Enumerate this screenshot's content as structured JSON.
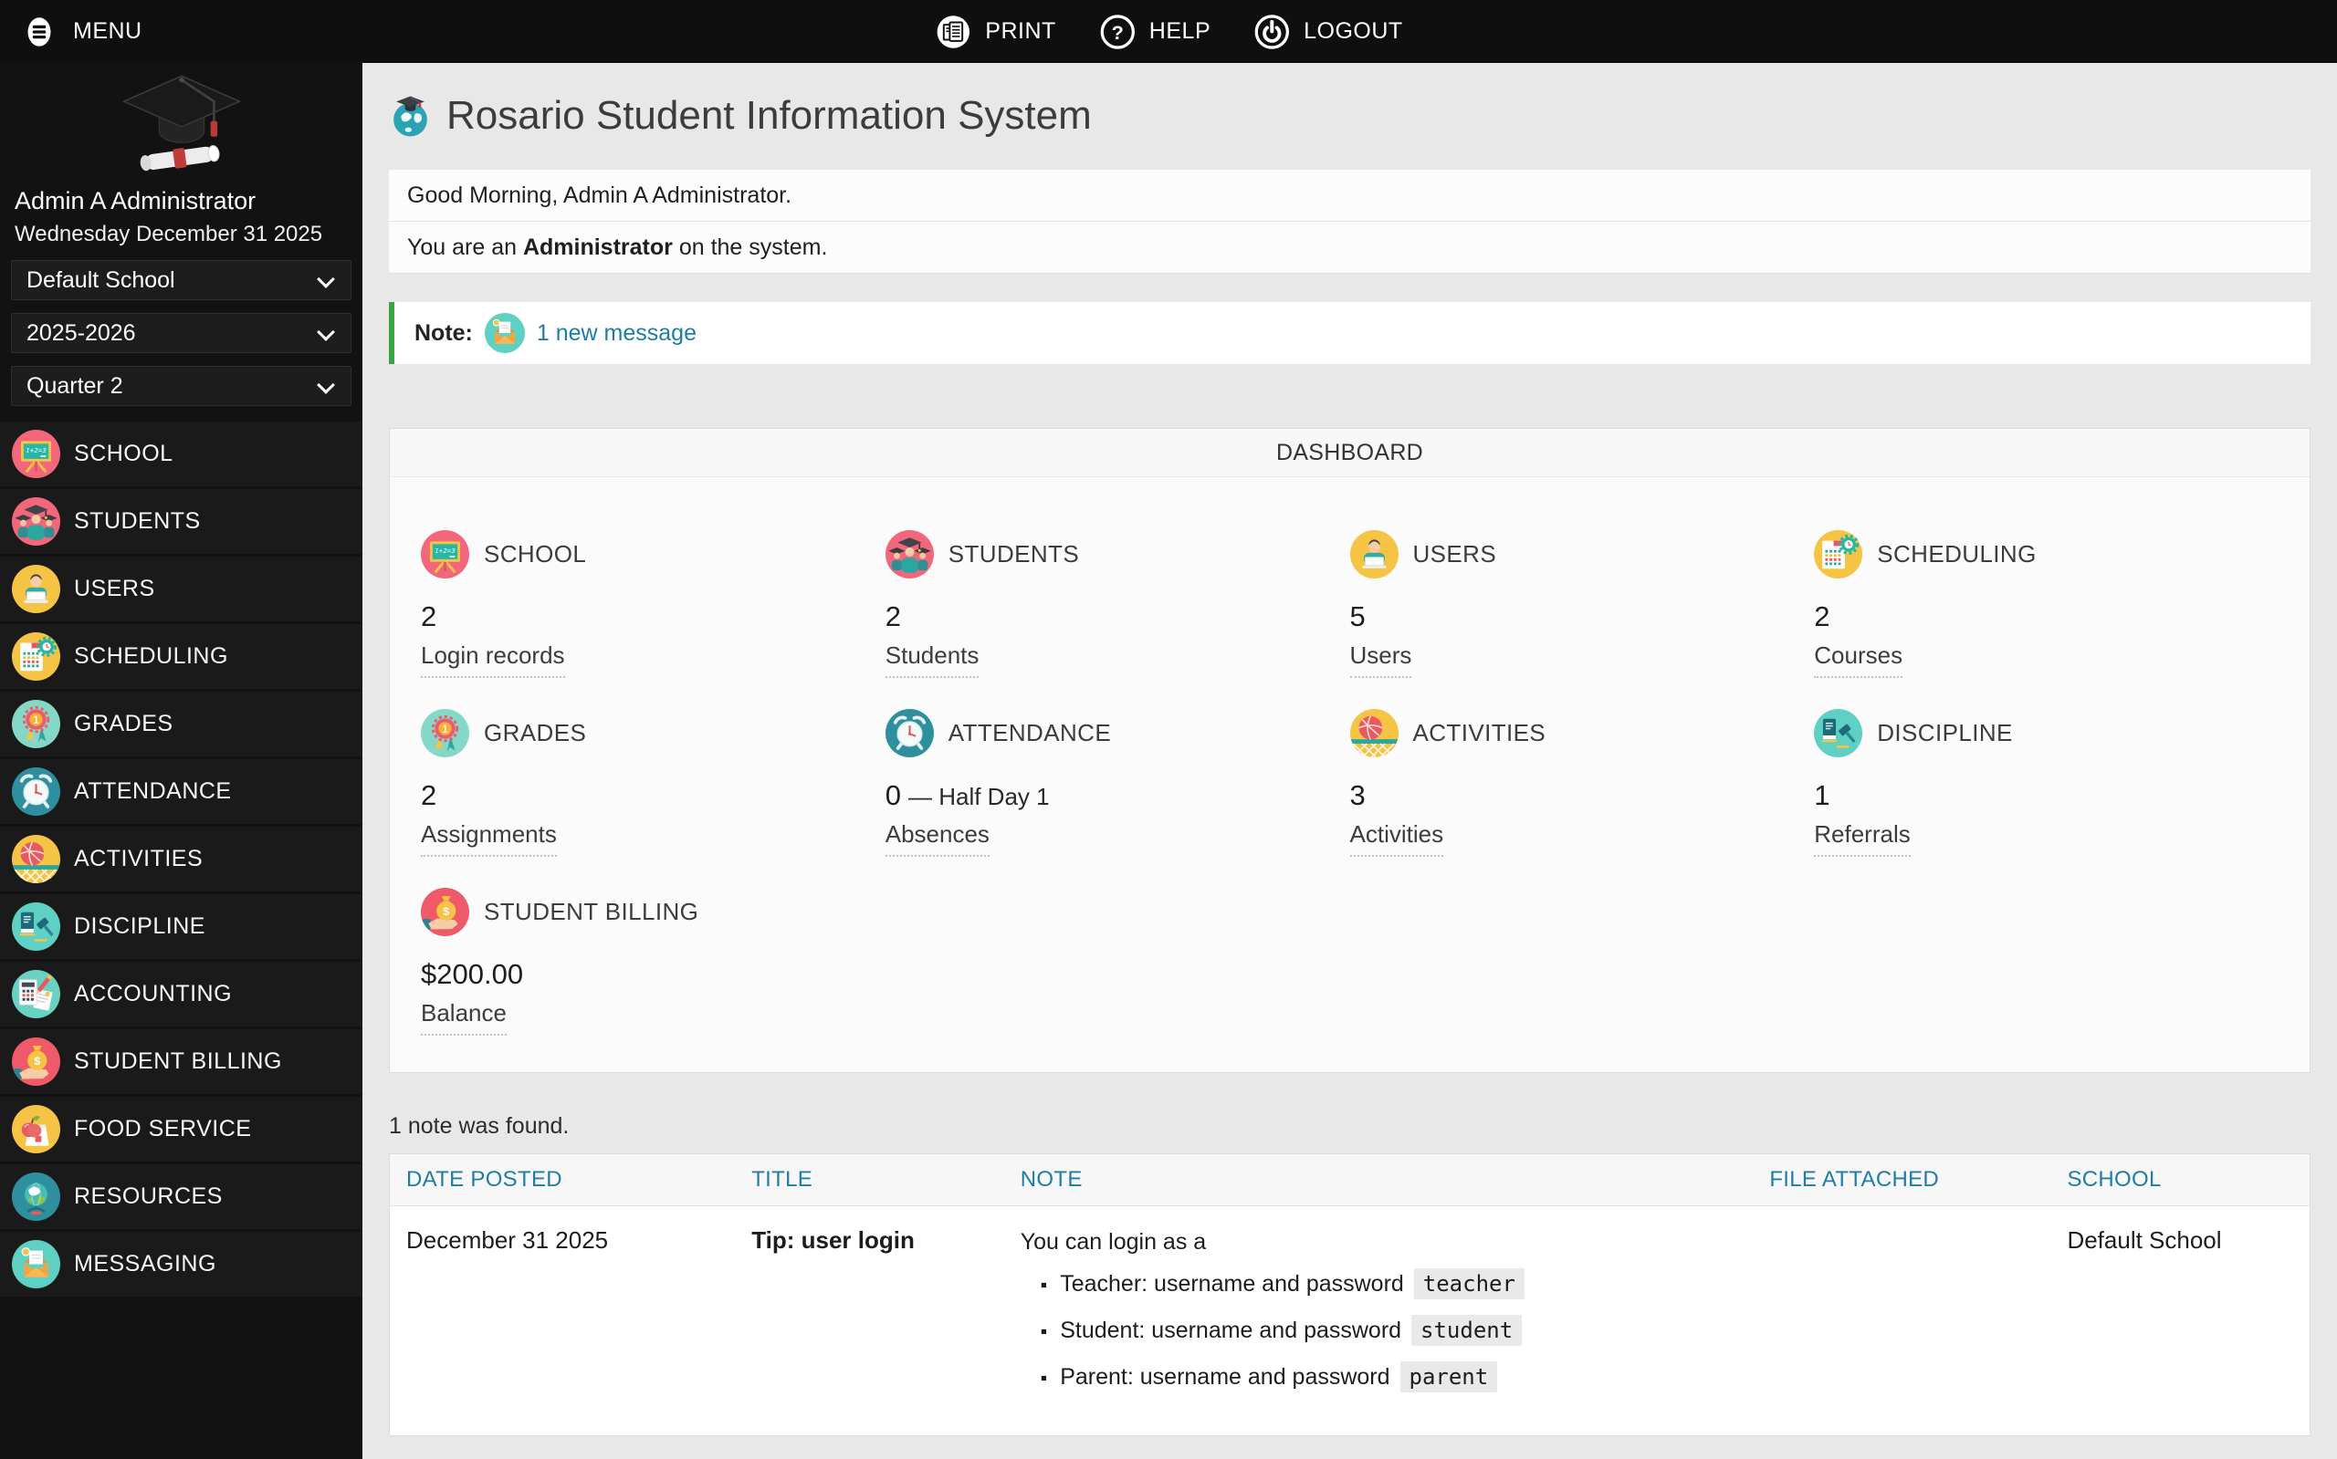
{
  "colors": {
    "accent_link": "#1f7ca6",
    "note_border": "#3aa63f",
    "topbar_bg": "#0f0f0f",
    "sidebar_bg": "#121212"
  },
  "topbar": {
    "menu_label": "MENU",
    "actions": [
      {
        "label": "PRINT",
        "icon": "print-icon"
      },
      {
        "label": "HELP",
        "icon": "help-icon"
      },
      {
        "label": "LOGOUT",
        "icon": "logout-icon"
      }
    ]
  },
  "sidebar": {
    "user_name": "Admin A Administrator",
    "date": "Wednesday December 31 2025",
    "selects": [
      {
        "value": "Default School"
      },
      {
        "value": "2025-2026"
      },
      {
        "value": "Quarter 2"
      }
    ],
    "items": [
      {
        "label": "SCHOOL",
        "icon": "school-icon"
      },
      {
        "label": "STUDENTS",
        "icon": "students-icon"
      },
      {
        "label": "USERS",
        "icon": "users-icon"
      },
      {
        "label": "SCHEDULING",
        "icon": "scheduling-icon"
      },
      {
        "label": "GRADES",
        "icon": "grades-icon"
      },
      {
        "label": "ATTENDANCE",
        "icon": "attendance-icon"
      },
      {
        "label": "ACTIVITIES",
        "icon": "activities-icon"
      },
      {
        "label": "DISCIPLINE",
        "icon": "discipline-icon"
      },
      {
        "label": "ACCOUNTING",
        "icon": "accounting-icon"
      },
      {
        "label": "STUDENT BILLING",
        "icon": "billing-icon"
      },
      {
        "label": "FOOD SERVICE",
        "icon": "foodservice-icon"
      },
      {
        "label": "RESOURCES",
        "icon": "resources-icon"
      },
      {
        "label": "MESSAGING",
        "icon": "messaging-icon"
      }
    ]
  },
  "header": {
    "title": "Rosario Student Information System"
  },
  "greeting": {
    "line1": "Good Morning, Admin A Administrator.",
    "line2_prefix": "You are an ",
    "line2_bold": "Administrator",
    "line2_suffix": " on the system."
  },
  "note_banner": {
    "label": "Note:",
    "link": "1 new message"
  },
  "dashboard": {
    "title": "DASHBOARD",
    "cards": [
      {
        "title": "SCHOOL",
        "icon": "school-icon",
        "value": "2",
        "link": "Login records"
      },
      {
        "title": "STUDENTS",
        "icon": "students-icon",
        "value": "2",
        "link": "Students"
      },
      {
        "title": "USERS",
        "icon": "users-icon",
        "value": "5",
        "link": "Users"
      },
      {
        "title": "SCHEDULING",
        "icon": "scheduling-icon",
        "value": "2",
        "link": "Courses"
      },
      {
        "title": "GRADES",
        "icon": "grades-icon",
        "value": "2",
        "link": "Assignments"
      },
      {
        "title": "ATTENDANCE",
        "icon": "attendance-icon",
        "value": "0",
        "value_suffix": "— Half Day 1",
        "link": "Absences"
      },
      {
        "title": "ACTIVITIES",
        "icon": "activities-icon",
        "value": "3",
        "link": "Activities"
      },
      {
        "title": "DISCIPLINE",
        "icon": "discipline-icon",
        "value": "1",
        "link": "Referrals"
      },
      {
        "title": "STUDENT BILLING",
        "icon": "billing-icon",
        "value": "$200.00",
        "link": "Balance"
      }
    ]
  },
  "notes": {
    "count_text": "1 note was found.",
    "columns": [
      "DATE POSTED",
      "TITLE",
      "NOTE",
      "FILE ATTACHED",
      "SCHOOL"
    ],
    "row": {
      "date_posted": "December 31 2025",
      "title": "Tip: user login",
      "note_intro": "You can login as a",
      "note_items": [
        {
          "text": "Teacher: username and password",
          "code": "teacher"
        },
        {
          "text": "Student: username and password",
          "code": "student"
        },
        {
          "text": "Parent: username and password",
          "code": "parent"
        }
      ],
      "file_attached": "",
      "school": "Default School"
    }
  }
}
